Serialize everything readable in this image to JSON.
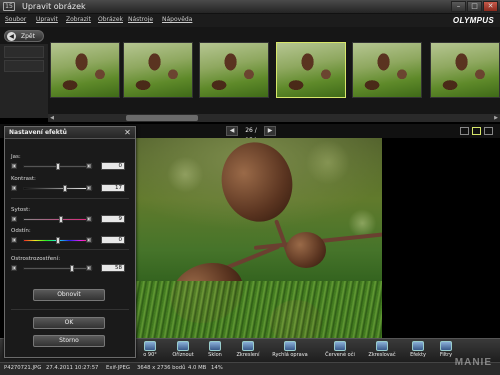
{
  "window": {
    "title": "Upravit obrázek",
    "app_icon_text": "15"
  },
  "menu": [
    "Soubor",
    "Upravit",
    "Zobrazit",
    "Obrázek",
    "Nástroje",
    "Nápověda"
  ],
  "brand": "OLYMPUS",
  "back_button": {
    "label": "Zpět"
  },
  "navigation": {
    "counter": "26 / 154"
  },
  "panel": {
    "title": "Nastavení efektů",
    "adjustments": [
      {
        "label": "Jas:",
        "value": "0",
        "level": 0.5
      },
      {
        "label": "Kontrast:",
        "value": "17",
        "level": 0.6
      },
      {
        "label": "Sytost:",
        "value": "9",
        "level": 0.55
      },
      {
        "label": "Odstín:",
        "value": "0",
        "level": 0.5
      },
      {
        "label": "Ostrostrozostření:",
        "value": "58",
        "level": 0.7
      }
    ],
    "reset_label": "Obnovit",
    "ok_label": "OK",
    "cancel_label": "Storno"
  },
  "toolbar": [
    "o 90°",
    "Oříznout",
    "Sklon",
    "Zkreslení",
    "Rychlá oprava",
    "Červené oči",
    "Zkreslovač",
    "Efekty",
    "Filtry"
  ],
  "status": {
    "filename": "P4270721.JPG",
    "datetime": "27.4.2011 10:27:57",
    "format": "Exif-JPEG",
    "dimensions": "3648 x 2736 bodů",
    "size": "4.0 MB",
    "zoom": "14%"
  },
  "watermark": "MANIE"
}
